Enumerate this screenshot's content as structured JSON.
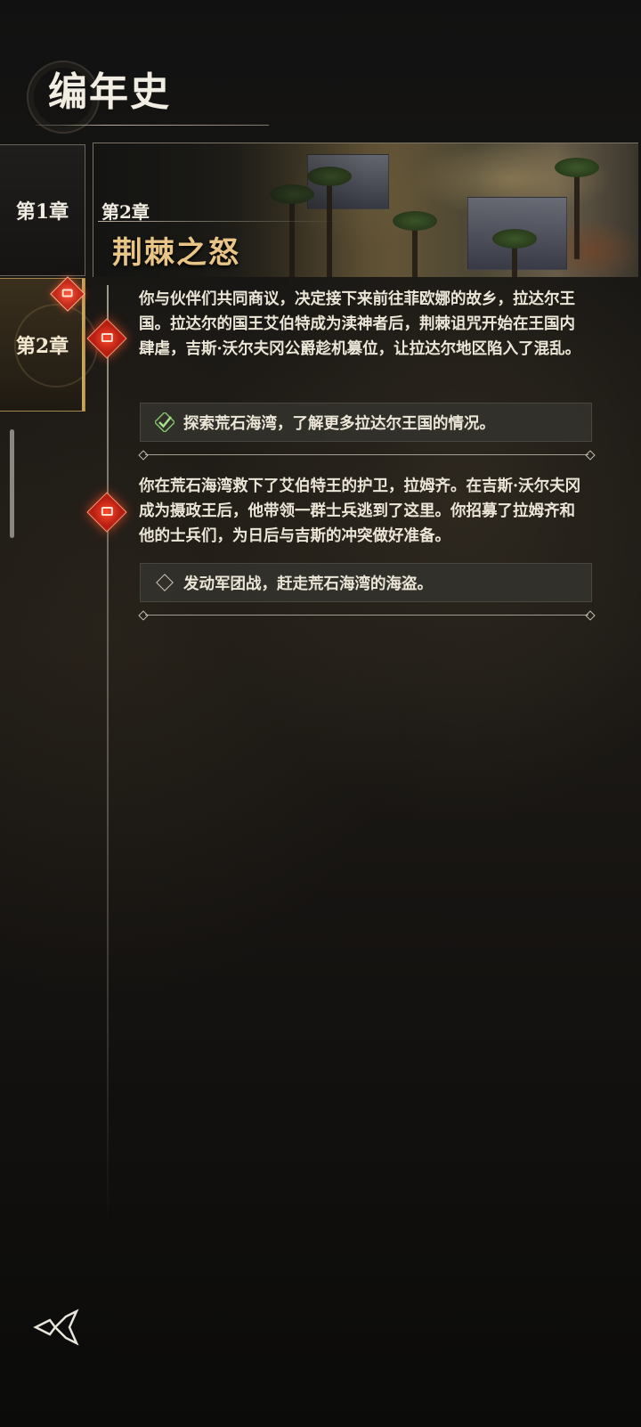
{
  "header": {
    "title": "编年史"
  },
  "tabs": [
    {
      "label": "第1章"
    },
    {
      "label": "第2章"
    }
  ],
  "chapter": {
    "number": "第2章",
    "title": "荆棘之怒"
  },
  "entries": [
    {
      "text": "你与伙伴们共同商议，决定接下来前往菲欧娜的故乡，拉达尔王国。拉达尔的国王艾伯特成为渎神者后，荆棘诅咒开始在王国内肆虐，吉斯·沃尔夫冈公爵趁机篡位，让拉达尔地区陷入了混乱。",
      "objective": "探索荒石海湾，了解更多拉达尔王国的情况。",
      "objective_status": "completed"
    },
    {
      "text": "你在荒石海湾救下了艾伯特王的护卫，拉姆齐。在吉斯·沃尔夫冈成为摄政王后，他带领一群士兵逃到了这里。你招募了拉姆齐和他的士兵们，为日后与吉斯的冲突做好准备。",
      "objective": "发动军团战，赶走荒石海湾的海盗。",
      "objective_status": "pending"
    }
  ],
  "colors": {
    "accent_gold": "#e8c486",
    "node_red": "#d8321f",
    "check_green": "#7fc36a"
  },
  "icons": {
    "reward": "treasure-chest-icon",
    "back": "back-arrow-icon"
  }
}
